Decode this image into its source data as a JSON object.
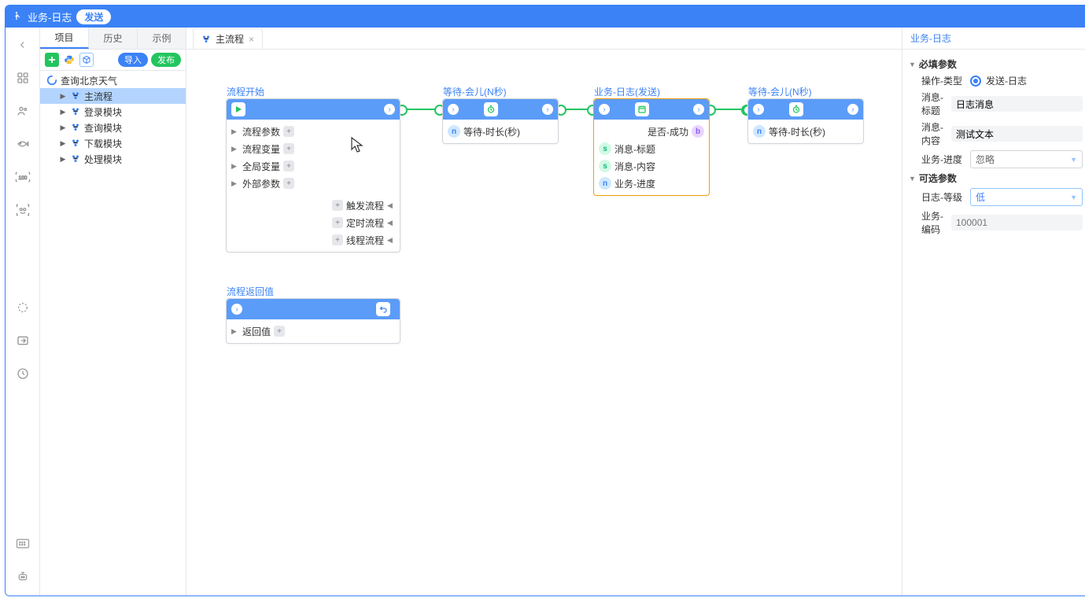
{
  "topbar": {
    "title": "业务-日志",
    "badge": "发送"
  },
  "sidebar": {
    "tabs": [
      "项目",
      "历史",
      "示例"
    ],
    "active_tab": 0,
    "toolbar": {
      "import": "导入",
      "publish": "发布"
    },
    "root": "查询北京天气",
    "modules": [
      "主流程",
      "登录模块",
      "查询模块",
      "下载模块",
      "处理模块"
    ],
    "selected": 0
  },
  "doc_tab": {
    "label": "主流程"
  },
  "canvas": {
    "node_start": {
      "title": "流程开始",
      "rows_left": [
        "流程参数",
        "流程变量",
        "全局变量",
        "外部参数"
      ],
      "rows_right": [
        "触发流程",
        "定时流程",
        "线程流程"
      ]
    },
    "node_wait1": {
      "title": "等待-会儿(N秒)",
      "param": "等待-时长(秒)"
    },
    "node_log": {
      "title": "业务-日志(发送)",
      "out": "是否-成功",
      "params": [
        "消息-标题",
        "消息-内容",
        "业务-进度"
      ]
    },
    "node_wait2": {
      "title": "等待-会儿(N秒)",
      "param": "等待-时长(秒)"
    },
    "node_return": {
      "title": "流程返回值",
      "row": "返回值"
    }
  },
  "props": {
    "title": "业务-日志",
    "required_header": "必填参数",
    "optional_header": "可选参数",
    "op_type_label": "操作-类型",
    "op_type_value": "发送-日志",
    "msg_title_label": "消息-标题",
    "msg_title_value": "日志消息",
    "msg_content_label": "消息-内容",
    "msg_content_value": "测试文本",
    "progress_label": "业务-进度",
    "progress_value": "忽略",
    "log_level_label": "日志-等级",
    "log_level_value": "低",
    "biz_code_label": "业务-编码",
    "biz_code_placeholder": "100001"
  }
}
